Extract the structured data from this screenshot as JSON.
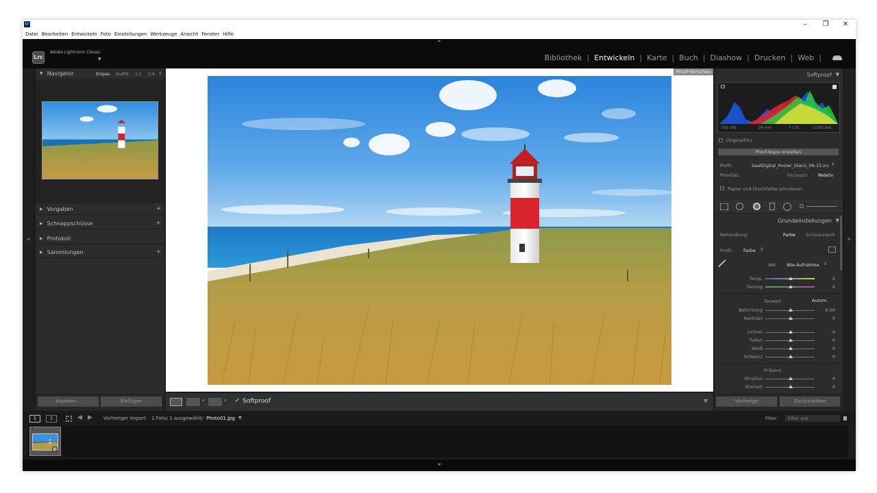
{
  "window": {
    "minimize": "–",
    "maximize": "❐",
    "close": "✕"
  },
  "menu": [
    "Datei",
    "Bearbeiten",
    "Entwickeln",
    "Foto",
    "Einstellungen",
    "Werkzeuge",
    "Ansicht",
    "Fenster",
    "Hilfe"
  ],
  "app": {
    "logo": "Lrc",
    "name": "Adobe Lightroom Classic"
  },
  "modules": [
    "Bibliothek",
    "Entwickeln",
    "Karte",
    "Buch",
    "Diashow",
    "Drucken",
    "Web"
  ],
  "active_module": "Entwickeln",
  "navigator": {
    "title": "Navigator",
    "zoom": [
      "Einpas.",
      "Ausfül.",
      "1:1",
      "1:4"
    ]
  },
  "left_sections": [
    "Vorgaben",
    "Schnappschüsse",
    "Protokoll",
    "Sammlungen"
  ],
  "left_buttons": {
    "copy": "Kopieren...",
    "paste": "Einfügen"
  },
  "proof_badge": "Proof-Vorschau",
  "toolbar": {
    "softproof": "Softproof",
    "check": "✓"
  },
  "right": {
    "softproof_title": "Softproof",
    "histogram_info": [
      "ISO 100",
      "24 mm",
      "f / 11",
      "1/100 Sek."
    ],
    "original": "Originalfoto",
    "proof_copy": "Proof-Kopie erstellen",
    "profile_label": "Profil:",
    "profile_value": "SaalDigital_Poster_Glanz_09-15.icc",
    "priority_label": "Priorität:",
    "perceptual": "Perzeptiv",
    "relative": "Relativ",
    "simulate": "Papier und Druckfarbe simulieren",
    "basic_title": "Grundeinstellungen",
    "treatment_label": "Behandlung:",
    "color": "Farbe",
    "bw": "Schwarzweiß",
    "profile2_label": "Profil:",
    "profile2_value": "Farbe",
    "wb_label": "WA:",
    "wb_value": "Wie Aufnahme",
    "temp": {
      "label": "Temp.",
      "value": "0"
    },
    "tint": {
      "label": "Tonung",
      "value": "0"
    },
    "tone_title": "Tonwert",
    "auto": "Autom.",
    "exposure": {
      "label": "Belichtung",
      "value": "0.00"
    },
    "contrast": {
      "label": "Kontrast",
      "value": "0"
    },
    "highlights": {
      "label": "Lichter",
      "value": "0"
    },
    "shadows": {
      "label": "Tiefen",
      "value": "0"
    },
    "whites": {
      "label": "Weiß",
      "value": "0"
    },
    "blacks": {
      "label": "Schwarz",
      "value": "0"
    },
    "presence": "Präsenz",
    "texture": {
      "label": "Struktur",
      "value": "0"
    },
    "clarity": {
      "label": "Klarheit",
      "value": "0"
    },
    "previous": "Vorherige",
    "reset": "Zurücksetzen"
  },
  "filmstrip": {
    "screen1": "1",
    "screen2": "2",
    "source": "Vorheriger Import",
    "count": "1 Foto/ 1 ausgewählt/",
    "filename": "Photo01.jpg",
    "filter_label": "Filter:",
    "filter_value": "Filter aus",
    "thumb_index": "1"
  },
  "colors": {
    "bg": "#1b1b1b",
    "panel": "#2c2c2c",
    "accent_red": "#d8242a"
  }
}
